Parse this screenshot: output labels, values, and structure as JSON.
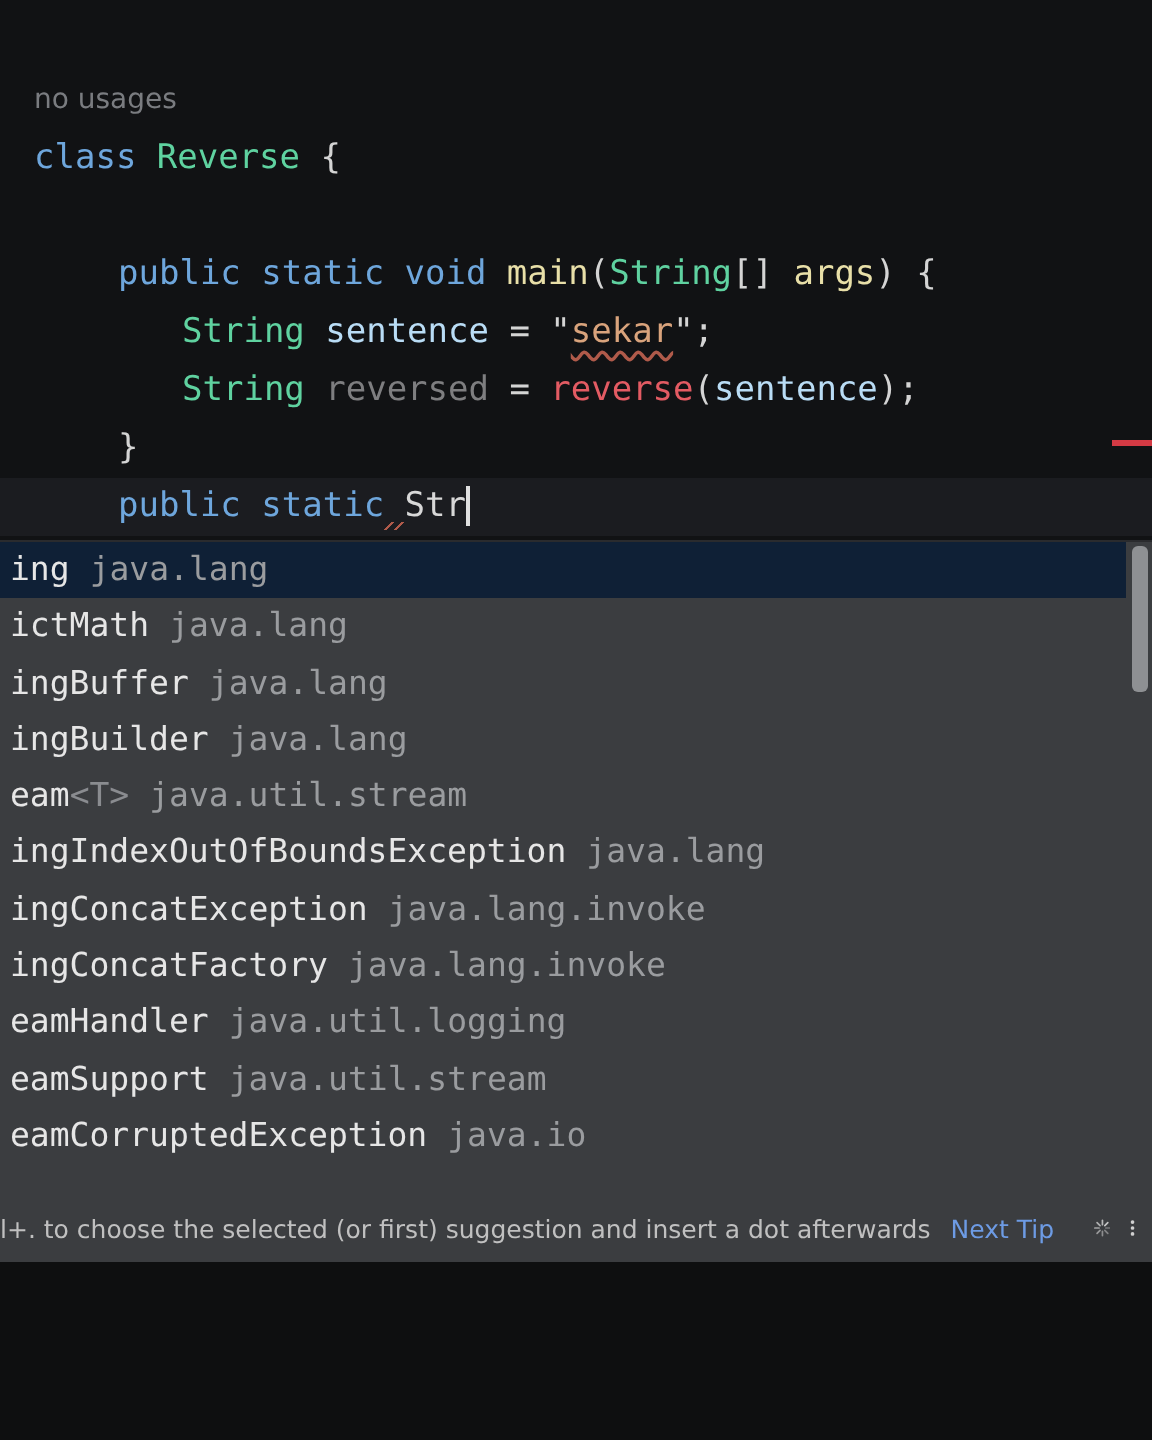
{
  "editor": {
    "hint": "no usages",
    "lines": [
      {
        "kind": "top",
        "tokens": [
          {
            "text": "class",
            "kind": "keyword"
          },
          {
            "text": "Reverse",
            "kind": "class",
            "gap": true
          },
          {
            "text": "{",
            "kind": "punct",
            "gap": true
          }
        ]
      },
      {
        "kind": "blank"
      },
      {
        "kind": "member",
        "tokens": [
          {
            "text": "public static void",
            "kind": "keyword"
          },
          {
            "text": "main",
            "kind": "method",
            "gap": true
          },
          {
            "text": "(",
            "kind": "punct"
          },
          {
            "text": "String",
            "kind": "class"
          },
          {
            "text": "[]",
            "kind": "punct"
          },
          {
            "text": "args",
            "kind": "method",
            "gap": true
          },
          {
            "text": ")",
            "kind": "punct"
          },
          {
            "text": "{",
            "kind": "punct",
            "gap": true
          }
        ]
      },
      {
        "kind": "statement",
        "tokens": [
          {
            "text": "String",
            "kind": "class"
          },
          {
            "text": "sentence",
            "kind": "variable",
            "gap": true
          },
          {
            "text": "=",
            "kind": "punct",
            "gap": true
          },
          {
            "text": "\"",
            "kind": "punct",
            "gap": true
          },
          {
            "text": "sekar",
            "kind": "string",
            "squiggle": true
          },
          {
            "text": "\";",
            "kind": "punct"
          }
        ]
      },
      {
        "kind": "statement",
        "tokens": [
          {
            "text": "String",
            "kind": "class"
          },
          {
            "text": "reversed",
            "kind": "unused",
            "gap": true
          },
          {
            "text": "=",
            "kind": "punct",
            "gap": true
          },
          {
            "text": "reverse",
            "kind": "error",
            "gap": true
          },
          {
            "text": "(",
            "kind": "punct"
          },
          {
            "text": "sentence",
            "kind": "variable"
          },
          {
            "text": ");",
            "kind": "punct"
          }
        ]
      },
      {
        "kind": "member",
        "tokens": [
          {
            "text": "}",
            "kind": "punct"
          }
        ]
      },
      {
        "kind": "member",
        "current": true,
        "tokens": [
          {
            "text": "public static",
            "kind": "keyword"
          },
          {
            "text": "Str",
            "kind": "typed",
            "gap": true,
            "gap_squiggle": true,
            "caret": true
          }
        ]
      }
    ]
  },
  "completion": {
    "items": [
      {
        "name": "ing",
        "package": "java.lang",
        "selected": true
      },
      {
        "name": "ictMath",
        "package": "java.lang",
        "selected": false
      },
      {
        "name": "ingBuffer",
        "package": "java.lang",
        "selected": false
      },
      {
        "name": "ingBuilder",
        "package": "java.lang",
        "selected": false
      },
      {
        "name": "eam",
        "type_params": "<T>",
        "package": "java.util.stream",
        "selected": false
      },
      {
        "name": "ingIndexOutOfBoundsException",
        "package": "java.lang",
        "selected": false
      },
      {
        "name": "ingConcatException",
        "package": "java.lang.invoke",
        "selected": false
      },
      {
        "name": "ingConcatFactory",
        "package": "java.lang.invoke",
        "selected": false
      },
      {
        "name": "eamHandler",
        "package": "java.util.logging",
        "selected": false
      },
      {
        "name": "eamSupport",
        "package": "java.util.stream",
        "selected": false
      },
      {
        "name": "eamCorruptedException",
        "package": "java.io",
        "selected": false
      }
    ],
    "tip": "l+. to choose the selected (or first) suggestion and insert a dot afterwards",
    "next_tip": "Next Tip"
  }
}
